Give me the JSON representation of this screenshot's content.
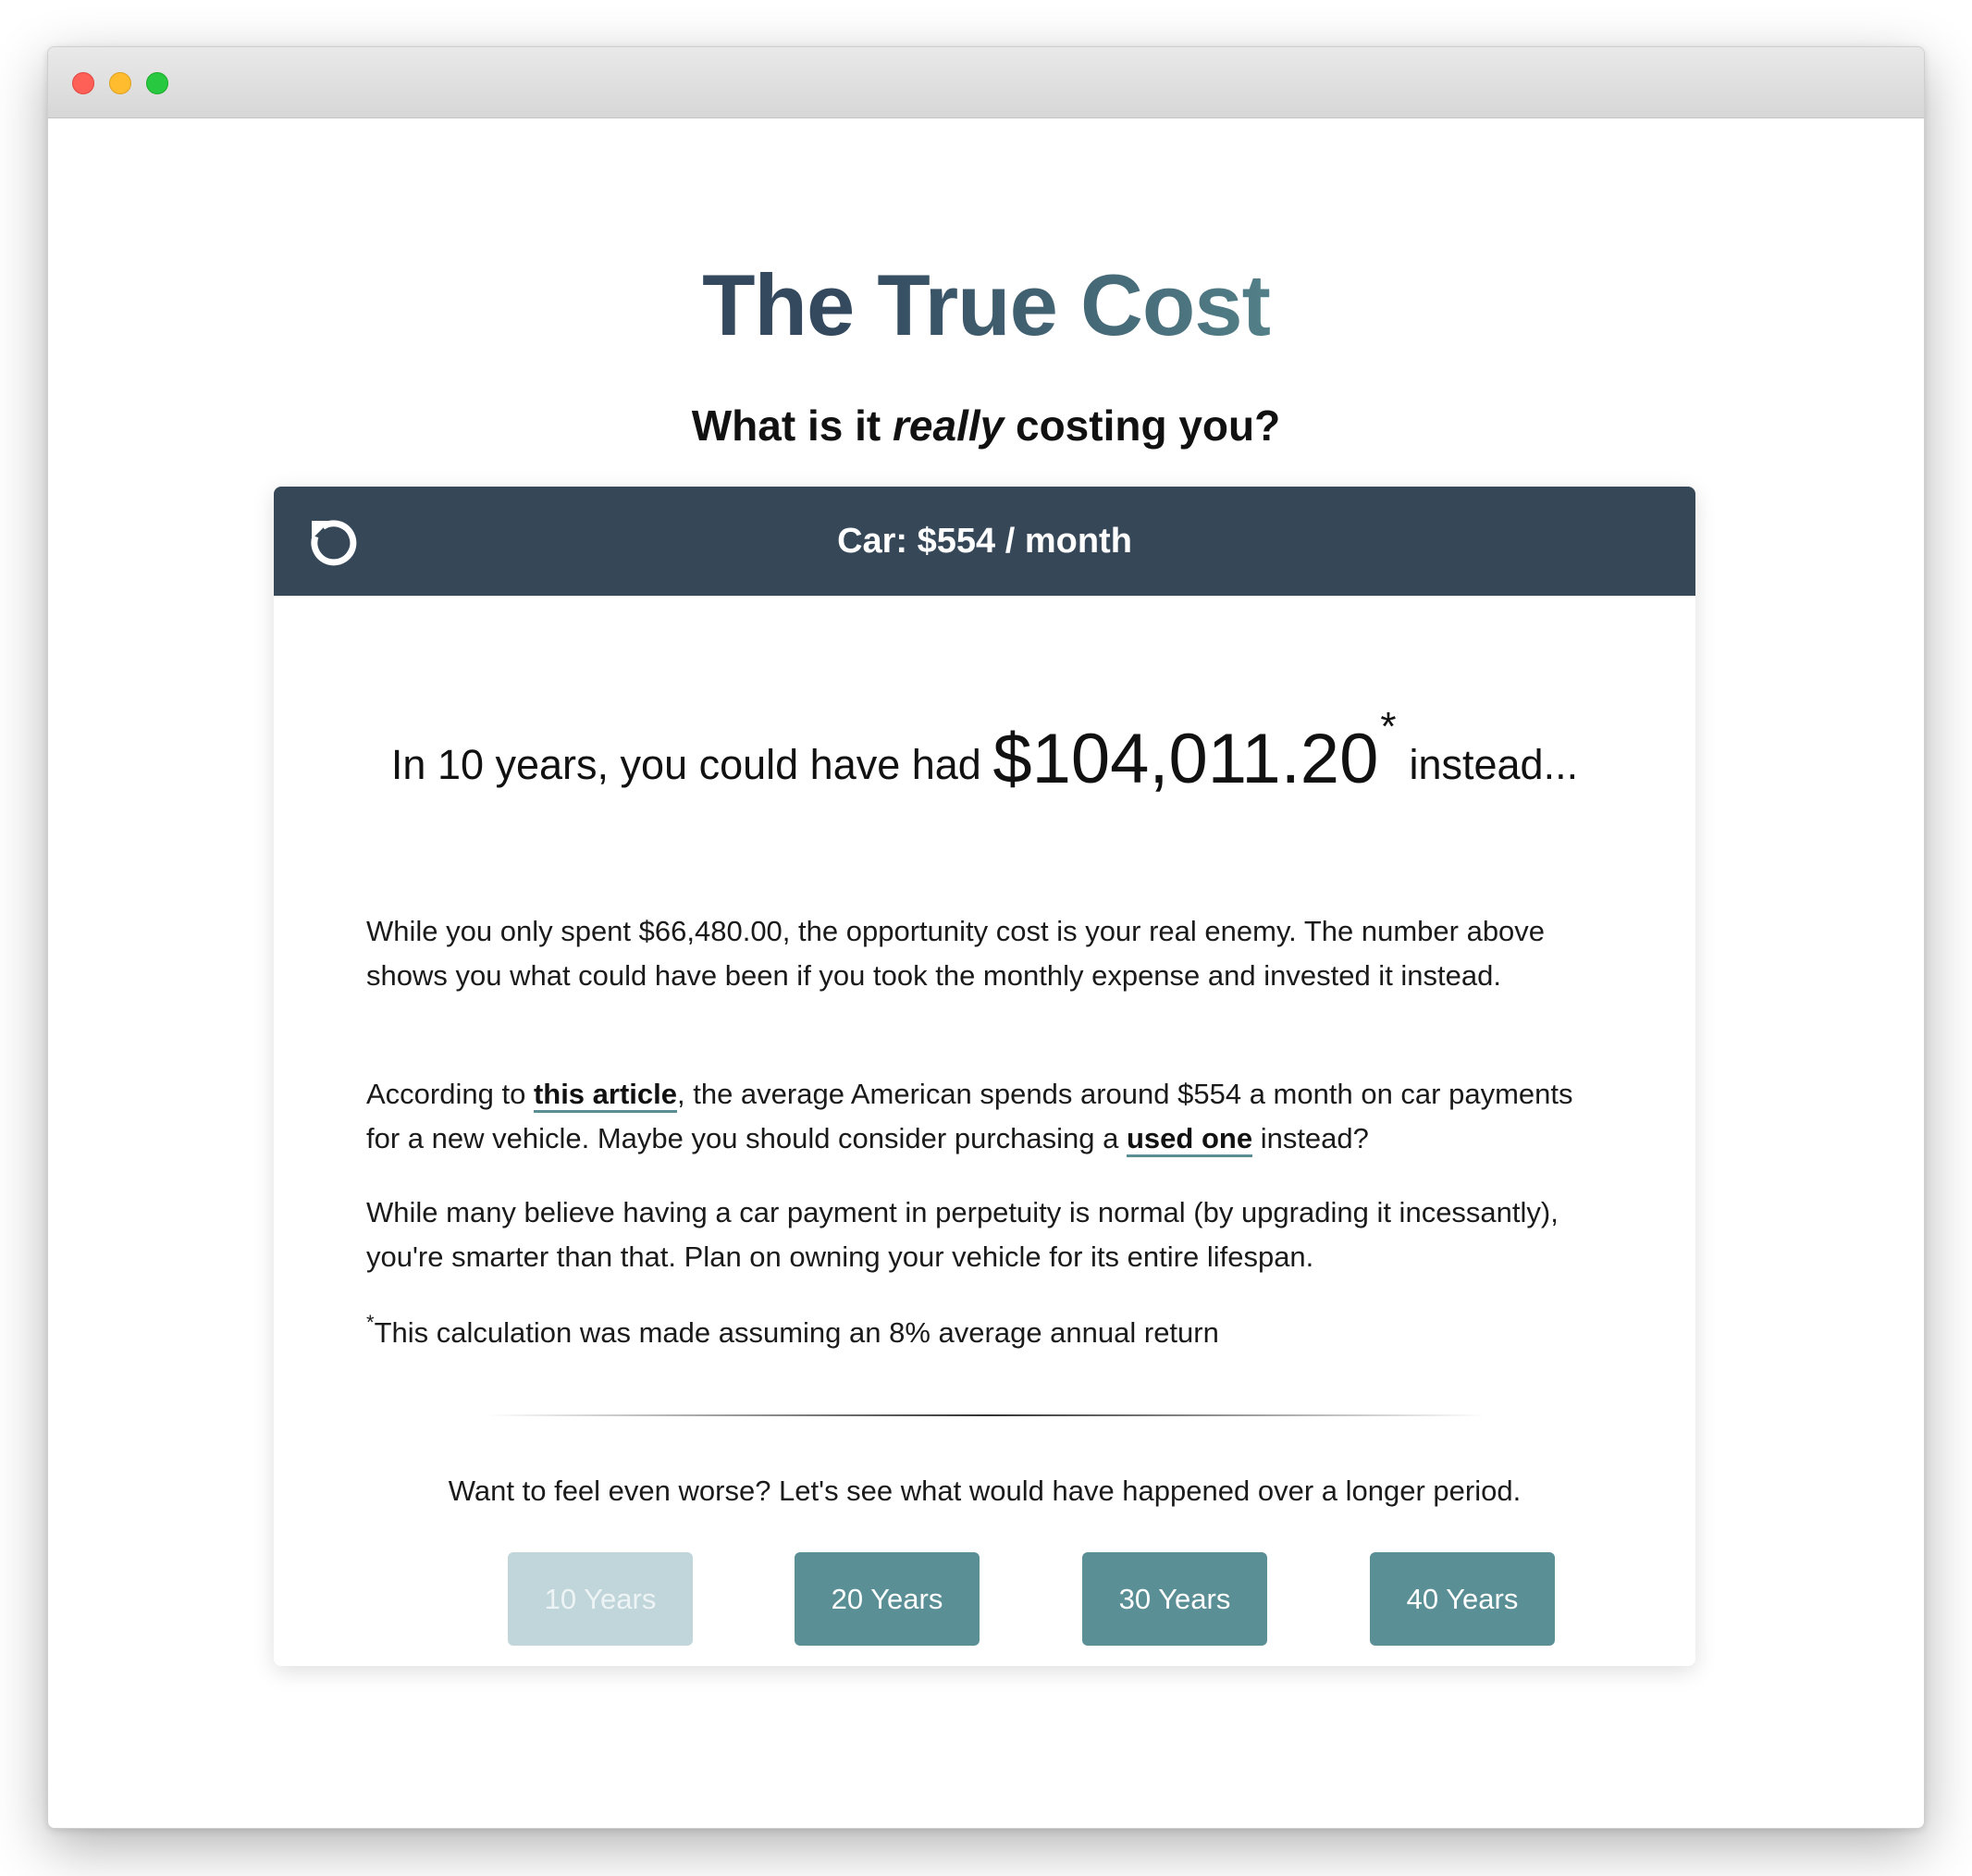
{
  "page": {
    "title": "The True Cost",
    "subtitle_pre": "What is it ",
    "subtitle_em": "really",
    "subtitle_post": " costing you?"
  },
  "card": {
    "header_title": "Car: $554 / month",
    "reset_icon": "reset-icon",
    "headline_pre": "In 10 years, you could have had ",
    "headline_amount": "$104,011.20",
    "headline_asterisk": "*",
    "headline_post": "instead...",
    "p1": "While you only spent $66,480.00, the opportunity cost is your real enemy. The number above shows you what could have been if you took the monthly expense and invested it instead.",
    "p2_pre": "According to ",
    "p2_link1": "this article",
    "p2_mid": ", the average American spends around $554 a month on car payments for a new vehicle. Maybe you should consider purchasing a ",
    "p2_link2": "used one",
    "p2_post": " instead?",
    "p3": "While many believe having a car payment in perpetuity is normal (by upgrading it incessantly), you're smarter than that. Plan on owning your vehicle for its entire lifespan.",
    "footnote_star": "*",
    "footnote": "This calculation was made assuming an 8% average annual return",
    "prompt": "Want to feel even worse? Let's see what would have happened over a longer period.",
    "buttons": [
      {
        "label": "10 Years",
        "active": true
      },
      {
        "label": "20 Years",
        "active": false
      },
      {
        "label": "30 Years",
        "active": false
      },
      {
        "label": "40 Years",
        "active": false
      }
    ]
  },
  "colors": {
    "header_bg": "#364758",
    "accent": "#5b8f96",
    "accent_disabled": "#c0d6da",
    "title_start": "#34495e",
    "title_end": "#527f88"
  }
}
